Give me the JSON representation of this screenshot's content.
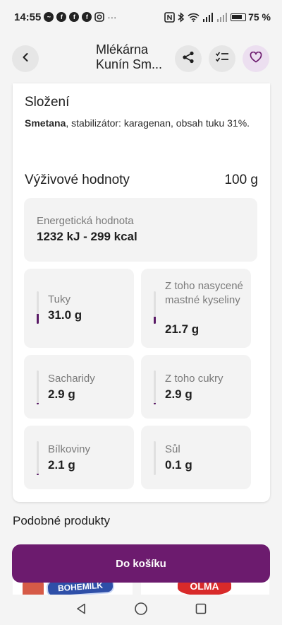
{
  "status": {
    "time": "14:55",
    "extra": "···",
    "battery": "75 %"
  },
  "header": {
    "title_line1": "Mlékárna",
    "title_line2": "Kunín Sm..."
  },
  "composition": {
    "title": "Složení",
    "text_bold": "Smetana",
    "text_rest": ", stabilizátor: karagenan, obsah tuku 31%."
  },
  "nutrition": {
    "title": "Výživové hodnoty",
    "amount": "100 g",
    "energy_label": "Energetická hodnota",
    "energy_value": "1232 kJ - 299 kcal",
    "items": [
      {
        "label": "Tuky",
        "value": "31.0 g",
        "fill": 0.31
      },
      {
        "label": "Z toho nasycené mastné kyseliny",
        "value": "21.7 g",
        "fill": 0.22
      },
      {
        "label": "Sacharidy",
        "value": "2.9 g",
        "fill": 0.03
      },
      {
        "label": "Z toho cukry",
        "value": "2.9 g",
        "fill": 0.03
      },
      {
        "label": "Bílkoviny",
        "value": "2.1 g",
        "fill": 0.02
      },
      {
        "label": "Sůl",
        "value": "0.1 g",
        "fill": 0.0
      }
    ]
  },
  "similar": {
    "title": "Podobné produkty",
    "brand1": "BOHEMILK",
    "brand2": "OLMA"
  },
  "cart_button": "Do košíku",
  "colors": {
    "accent": "#6c1b6e",
    "fill": "#5a1a66"
  },
  "icons": {
    "back": "arrow-left-icon",
    "share": "share-icon",
    "list": "checklist-icon",
    "favorite": "heart-icon"
  }
}
